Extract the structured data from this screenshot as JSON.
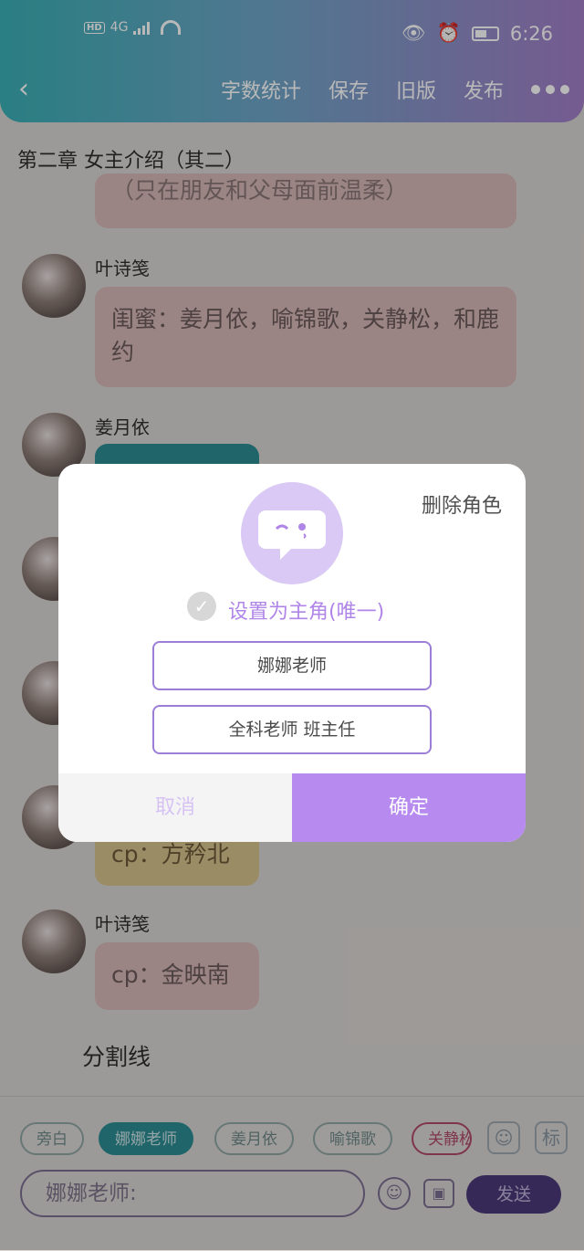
{
  "status_bar": {
    "hd": "HD",
    "network": "4G",
    "time": "6:26",
    "icons": [
      "wifi-icon",
      "eye-icon",
      "alarm-icon",
      "battery-icon",
      "signal-icon"
    ]
  },
  "header": {
    "back": "‹",
    "actions": [
      "字数统计",
      "保存",
      "旧版",
      "发布"
    ]
  },
  "chapter_title": "第二章  女主介绍（其二）",
  "messages": [
    {
      "speaker": "",
      "text": "（只在朋友和父母面前温柔）"
    },
    {
      "speaker": "叶诗笺",
      "text": "闺蜜：姜月依，喻锦歌，关静松，和鹿约"
    },
    {
      "speaker": "姜月依",
      "text": ""
    },
    {
      "speaker": "",
      "text": "cp：方矜北"
    },
    {
      "speaker": "叶诗笺",
      "text": "cp：金映南"
    }
  ],
  "divider_text": "分割线",
  "bottom": {
    "chips": [
      "旁白",
      "娜娜老师",
      "姜月依",
      "喻锦歌",
      "关静松"
    ],
    "icon_tag": "标",
    "input_placeholder": "娜娜老师:",
    "send": "发送"
  },
  "dialog": {
    "delete_role": "删除角色",
    "set_main_label": "设置为主角(唯一)",
    "name_value": "娜娜老师",
    "desc_value": "全科老师 班主任",
    "cancel": "取消",
    "confirm": "确定"
  },
  "colors": {
    "header_gradient_start": "#3ab0b6",
    "header_gradient_end": "#a37fc8",
    "accent_purple": "#b78af0",
    "bubble_pink": "#d6b8b8",
    "bubble_teal": "#2b8d93",
    "bubble_yellow": "#d6c28c"
  }
}
